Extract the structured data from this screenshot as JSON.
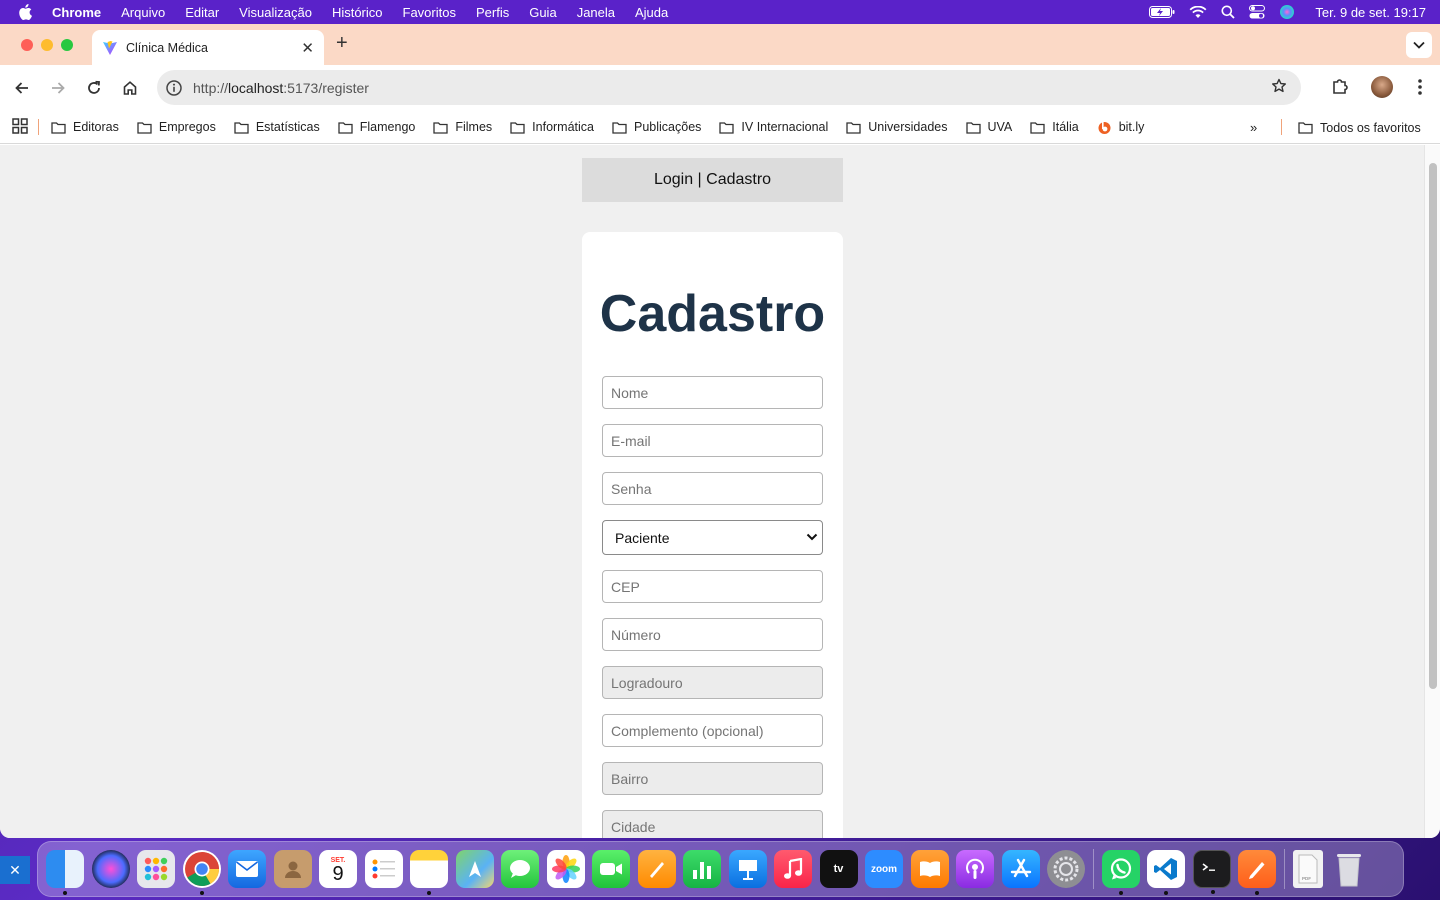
{
  "menubar": {
    "app_name": "Chrome",
    "items": [
      "Arquivo",
      "Editar",
      "Visualização",
      "Histórico",
      "Favoritos",
      "Perfis",
      "Guia",
      "Janela",
      "Ajuda"
    ],
    "clock": "Ter. 9 de set.  19:17"
  },
  "browser": {
    "tab_title": "Clínica Médica",
    "url_prefix": "http://",
    "url_host": "localhost",
    "url_rest": ":5173/register",
    "bookmarks": [
      "Editoras",
      "Empregos",
      "Estatísticas",
      "Flamengo",
      "Filmes",
      "Informática",
      "Publicações",
      "IV Internacional",
      "Universidades",
      "UVA",
      "Itália"
    ],
    "bitly": "bit.ly",
    "more": "»",
    "all_bookmarks": "Todos os favoritos"
  },
  "page": {
    "nav_label": "Login | Cadastro",
    "title": "Cadastro",
    "placeholders": {
      "nome": "Nome",
      "email": "E-mail",
      "senha": "Senha",
      "cep": "CEP",
      "numero": "Número",
      "logradouro": "Logradouro",
      "complemento": "Complemento (opcional)",
      "bairro": "Bairro",
      "cidade": "Cidade"
    },
    "role_selected": "Paciente"
  },
  "dock": {
    "calendar_month": "SET.",
    "calendar_day": "9",
    "zoom_label": "zoom",
    "tv_label": "tv"
  },
  "colors": {
    "menubar": "#5a22c9",
    "tabstrip": "#fbd9c6",
    "title_text": "#1e3348",
    "page_bg": "#f0f0f0"
  }
}
